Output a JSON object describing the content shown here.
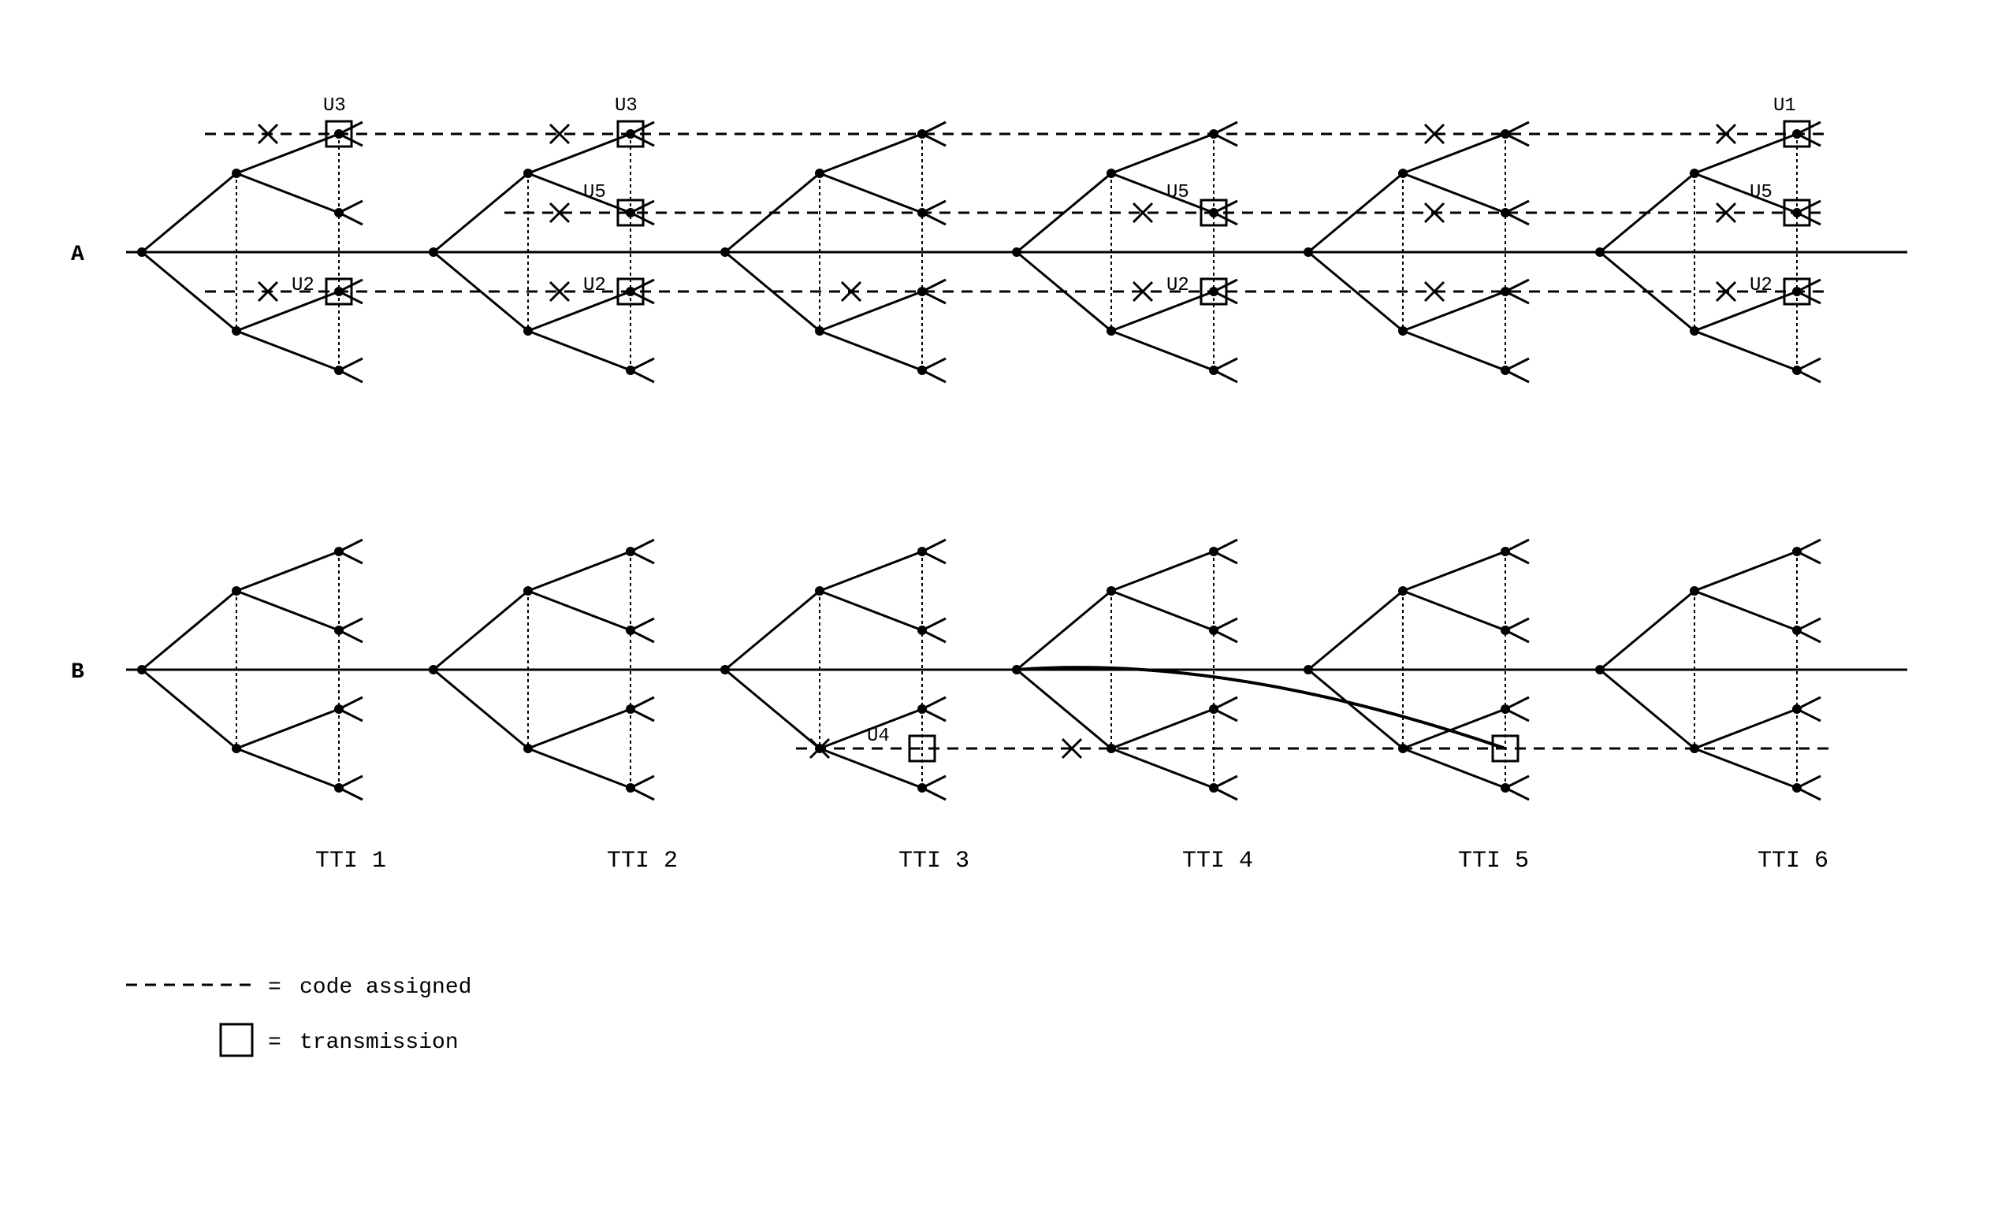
{
  "rows": {
    "A": {
      "label": "A"
    },
    "B": {
      "label": "B"
    }
  },
  "tti_labels": [
    "TTI 1",
    "TTI 2",
    "TTI 3",
    "TTI 4",
    "TTI 5",
    "TTI 6"
  ],
  "annotations_A": {
    "u3_labels": [
      "U3",
      "U3"
    ],
    "u5_labels": [
      "U5",
      "U5",
      "U5"
    ],
    "u2_labels": [
      "U2",
      "U2",
      "U2",
      "U2"
    ],
    "u1_label": "U1"
  },
  "annotations_B": {
    "u4_label": "U4"
  },
  "legend": {
    "code_assigned": "code assigned",
    "transmission": "transmission"
  }
}
